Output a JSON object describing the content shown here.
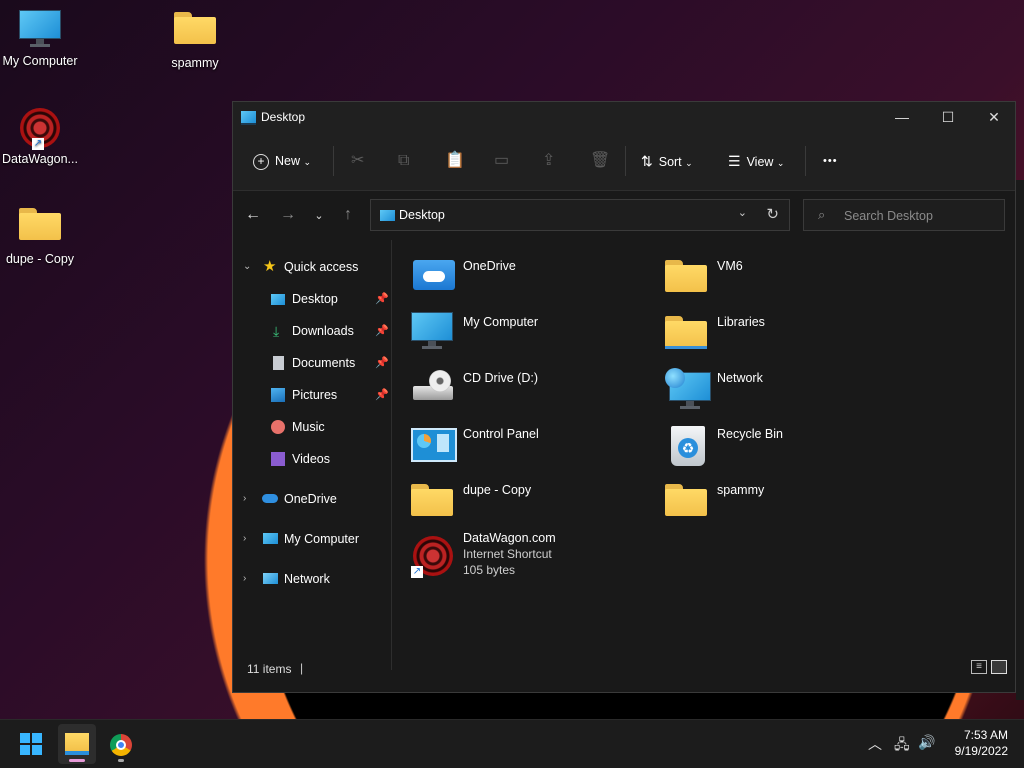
{
  "desktop": {
    "icons": [
      {
        "label": "My Computer"
      },
      {
        "label": "spammy"
      },
      {
        "label": "DataWagon..."
      },
      {
        "label": "dupe - Copy"
      }
    ]
  },
  "window": {
    "title": "Desktop",
    "controls": {
      "minimize": "—",
      "maximize": "☐",
      "close": "✕"
    }
  },
  "toolbar": {
    "new_label": "New",
    "sort_label": "Sort",
    "view_label": "View",
    "more_label": "•••"
  },
  "address": {
    "path": "Desktop",
    "search_placeholder": "Search Desktop"
  },
  "sidebar": {
    "quick_access": "Quick access",
    "items": [
      {
        "label": "Desktop",
        "pinned": true
      },
      {
        "label": "Downloads",
        "pinned": true
      },
      {
        "label": "Documents",
        "pinned": true
      },
      {
        "label": "Pictures",
        "pinned": true
      },
      {
        "label": "Music",
        "pinned": false
      },
      {
        "label": "Videos",
        "pinned": false
      }
    ],
    "roots": [
      {
        "label": "OneDrive"
      },
      {
        "label": "My Computer"
      },
      {
        "label": "Network"
      }
    ]
  },
  "content": {
    "items": [
      {
        "label": "OneDrive",
        "icon": "onedrive-folder-icon"
      },
      {
        "label": "VM6",
        "icon": "folder-icon"
      },
      {
        "label": "My Computer",
        "icon": "monitor-icon"
      },
      {
        "label": "Libraries",
        "icon": "libraries-icon"
      },
      {
        "label": "CD Drive (D:)",
        "icon": "cd-drive-icon"
      },
      {
        "label": "Network",
        "icon": "network-icon"
      },
      {
        "label": "Control Panel",
        "icon": "control-panel-icon"
      },
      {
        "label": "Recycle Bin",
        "icon": "recycle-bin-icon"
      },
      {
        "label": "dupe - Copy",
        "icon": "folder-icon"
      },
      {
        "label": "spammy",
        "icon": "folder-icon"
      },
      {
        "label": "DataWagon.com",
        "sub1": "Internet Shortcut",
        "sub2": "105 bytes",
        "icon": "datawagon-shortcut-icon"
      }
    ]
  },
  "status": {
    "count": "11 items"
  },
  "taskbar": {
    "time": "7:53 AM",
    "date": "9/19/2022"
  },
  "colors": {
    "accent": "#1e8fd6",
    "folder": "#f3c14a",
    "window_bg": "#191919"
  }
}
